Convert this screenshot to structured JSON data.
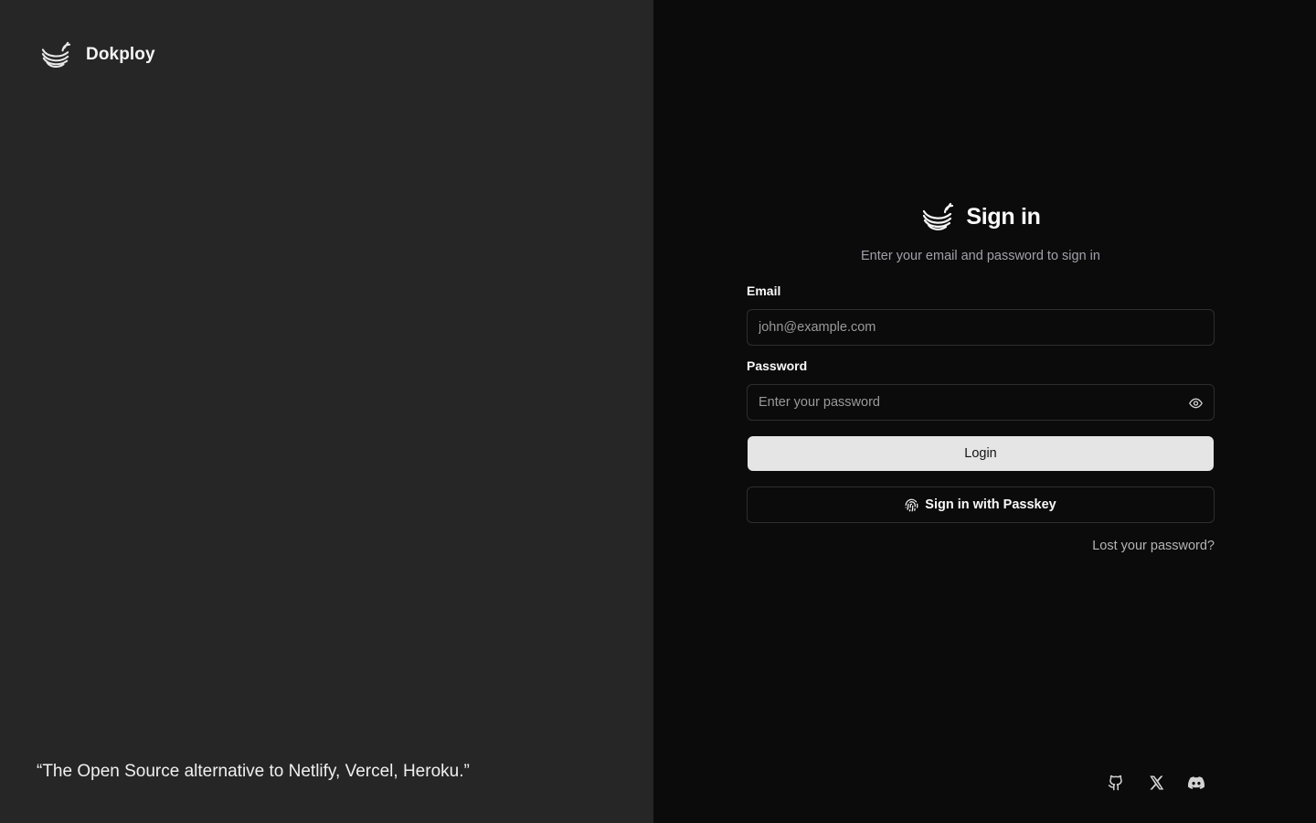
{
  "brand": {
    "name": "Dokploy",
    "tagline": "“The Open Source alternative to Netlify, Vercel, Heroku.”",
    "logo_icon": "dokploy-whale-logo"
  },
  "signin": {
    "title": "Sign in",
    "subtitle": "Enter your email and password to sign in"
  },
  "form": {
    "email_label": "Email",
    "email_placeholder": "john@example.com",
    "email_value": "",
    "password_label": "Password",
    "password_placeholder": "Enter your password",
    "password_value": "",
    "password_toggle_icon": "eye-icon",
    "login_label": "Login",
    "passkey_label": "Sign in with Passkey",
    "passkey_icon": "fingerprint-icon",
    "lost_password": "Lost your password?"
  },
  "social": [
    {
      "name": "github-icon"
    },
    {
      "name": "x-icon"
    },
    {
      "name": "discord-icon"
    }
  ],
  "colors": {
    "left_bg": "#262626",
    "right_bg": "#0b0b0b",
    "login_button_bg": "#e5e5e5",
    "border": "#2e2e2e",
    "muted_text": "#a1a1aa"
  }
}
